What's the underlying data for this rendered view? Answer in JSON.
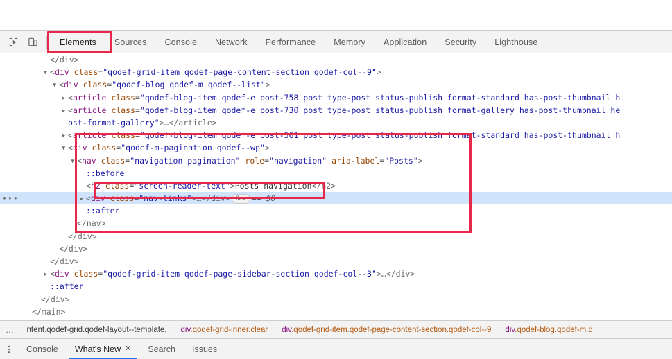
{
  "devtools": {
    "toolbar": {
      "icons": [
        {
          "name": "inspect-element-icon",
          "glyph": "inspect"
        },
        {
          "name": "device-toolbar-icon",
          "glyph": "device"
        }
      ],
      "tabs": [
        {
          "label": "Elements",
          "selected": true
        },
        {
          "label": "Sources",
          "selected": false
        },
        {
          "label": "Console",
          "selected": false
        },
        {
          "label": "Network",
          "selected": false
        },
        {
          "label": "Performance",
          "selected": false
        },
        {
          "label": "Memory",
          "selected": false
        },
        {
          "label": "Application",
          "selected": false
        },
        {
          "label": "Security",
          "selected": false
        },
        {
          "label": "Lighthouse",
          "selected": false
        }
      ]
    },
    "annotations": {
      "color": "#e8284a",
      "items": [
        {
          "name": "elements-tab-highlight"
        },
        {
          "name": "pagination-block-highlight"
        },
        {
          "name": "nav-links-line-highlight"
        }
      ]
    },
    "dom_tree": {
      "gutter_more_marker": "•••",
      "lines": [
        {
          "indent": 3,
          "triangle": "none",
          "clipped_top": true,
          "segments": [
            {
              "t": "punct",
              "v": "</div>"
            }
          ]
        },
        {
          "indent": 3,
          "triangle": "open",
          "segments": [
            {
              "t": "punct",
              "v": "<"
            },
            {
              "t": "tag",
              "v": "div"
            },
            {
              "t": "punct",
              "v": " "
            },
            {
              "t": "attr",
              "v": "class"
            },
            {
              "t": "punct",
              "v": "="
            },
            {
              "t": "val",
              "v": "\"qodef-grid-item qodef-page-content-section qodef-col--9\""
            },
            {
              "t": "punct",
              "v": ">"
            }
          ]
        },
        {
          "indent": 4,
          "triangle": "open",
          "segments": [
            {
              "t": "punct",
              "v": "<"
            },
            {
              "t": "tag",
              "v": "div"
            },
            {
              "t": "punct",
              "v": " "
            },
            {
              "t": "attr",
              "v": "class"
            },
            {
              "t": "punct",
              "v": "="
            },
            {
              "t": "val",
              "v": "\"qodef-blog qodef-m qodef--list\""
            },
            {
              "t": "punct",
              "v": ">"
            }
          ]
        },
        {
          "indent": 5,
          "triangle": "closed",
          "segments": [
            {
              "t": "punct",
              "v": "<"
            },
            {
              "t": "tag",
              "v": "article"
            },
            {
              "t": "punct",
              "v": " "
            },
            {
              "t": "attr",
              "v": "class"
            },
            {
              "t": "punct",
              "v": "="
            },
            {
              "t": "val",
              "v": "\"qodef-blog-item qodef-e post-758 post type-post status-publish format-standard has-post-thumbnail h"
            }
          ]
        },
        {
          "indent": 5,
          "triangle": "closed",
          "segments": [
            {
              "t": "punct",
              "v": "<"
            },
            {
              "t": "tag",
              "v": "article"
            },
            {
              "t": "punct",
              "v": " "
            },
            {
              "t": "attr",
              "v": "class"
            },
            {
              "t": "punct",
              "v": "="
            },
            {
              "t": "val",
              "v": "\"qodef-blog-item qodef-e post-730 post type-post status-publish format-gallery has-post-thumbnail he"
            }
          ]
        },
        {
          "indent": 5,
          "triangle": "none",
          "segments": [
            {
              "t": "val",
              "v": "ost-format-gallery\""
            },
            {
              "t": "punct",
              "v": ">"
            },
            {
              "t": "ellip",
              "v": "…"
            },
            {
              "t": "punct",
              "v": "</article>"
            }
          ]
        },
        {
          "indent": 5,
          "triangle": "closed",
          "segments": [
            {
              "t": "punct",
              "v": "<"
            },
            {
              "t": "tag",
              "v": "article"
            },
            {
              "t": "punct",
              "v": " "
            },
            {
              "t": "attr",
              "v": "class"
            },
            {
              "t": "punct",
              "v": "="
            },
            {
              "t": "val",
              "v": "\"qodef-blog-item qodef-e post-561 post type-post status-publish format-standard has-post-thumbnail h"
            }
          ]
        },
        {
          "indent": 5,
          "triangle": "open",
          "segments": [
            {
              "t": "punct",
              "v": "<"
            },
            {
              "t": "tag",
              "v": "div"
            },
            {
              "t": "punct",
              "v": " "
            },
            {
              "t": "attr",
              "v": "class"
            },
            {
              "t": "punct",
              "v": "="
            },
            {
              "t": "val",
              "v": "\"qodef-m-pagination qodef--wp\""
            },
            {
              "t": "punct",
              "v": ">"
            }
          ]
        },
        {
          "indent": 6,
          "triangle": "open",
          "segments": [
            {
              "t": "punct",
              "v": "<"
            },
            {
              "t": "tag",
              "v": "nav"
            },
            {
              "t": "punct",
              "v": " "
            },
            {
              "t": "attr",
              "v": "class"
            },
            {
              "t": "punct",
              "v": "="
            },
            {
              "t": "val",
              "v": "\"navigation pagination\""
            },
            {
              "t": "punct",
              "v": " "
            },
            {
              "t": "attr",
              "v": "role"
            },
            {
              "t": "punct",
              "v": "="
            },
            {
              "t": "val",
              "v": "\"navigation\""
            },
            {
              "t": "punct",
              "v": " "
            },
            {
              "t": "attr",
              "v": "aria-label"
            },
            {
              "t": "punct",
              "v": "="
            },
            {
              "t": "val",
              "v": "\"Posts\""
            },
            {
              "t": "punct",
              "v": ">"
            }
          ]
        },
        {
          "indent": 7,
          "triangle": "none",
          "segments": [
            {
              "t": "pseudo",
              "v": "::before"
            }
          ]
        },
        {
          "indent": 7,
          "triangle": "none",
          "segments": [
            {
              "t": "punct",
              "v": "<"
            },
            {
              "t": "tag",
              "v": "h2"
            },
            {
              "t": "punct",
              "v": " "
            },
            {
              "t": "attr",
              "v": "class"
            },
            {
              "t": "punct",
              "v": "="
            },
            {
              "t": "val",
              "v": "\"screen-reader-text\""
            },
            {
              "t": "punct",
              "v": ">"
            },
            {
              "t": "txt",
              "v": "Posts navigation"
            },
            {
              "t": "punct",
              "v": "</h2>"
            }
          ]
        },
        {
          "indent": 7,
          "triangle": "closed",
          "selected": true,
          "gutter_more": true,
          "segments": [
            {
              "t": "punct",
              "v": "<"
            },
            {
              "t": "tag",
              "v": "div"
            },
            {
              "t": "punct",
              "v": " "
            },
            {
              "t": "attr",
              "v": "class"
            },
            {
              "t": "punct",
              "v": "="
            },
            {
              "t": "val",
              "v": "\"nav-links\""
            },
            {
              "t": "punct",
              "v": ">"
            },
            {
              "t": "ellip",
              "v": "…"
            },
            {
              "t": "punct",
              "v": "</div>"
            },
            {
              "t": "badge",
              "v": "flex"
            },
            {
              "t": "dollar",
              "v": "== $0"
            }
          ]
        },
        {
          "indent": 7,
          "triangle": "none",
          "segments": [
            {
              "t": "pseudo",
              "v": "::after"
            }
          ]
        },
        {
          "indent": 6,
          "triangle": "none",
          "segments": [
            {
              "t": "punct",
              "v": "</nav>"
            }
          ]
        },
        {
          "indent": 5,
          "triangle": "none",
          "segments": [
            {
              "t": "punct",
              "v": "</div>"
            }
          ]
        },
        {
          "indent": 4,
          "triangle": "none",
          "segments": [
            {
              "t": "punct",
              "v": "</div>"
            }
          ]
        },
        {
          "indent": 3,
          "triangle": "none",
          "segments": [
            {
              "t": "punct",
              "v": "</div>"
            }
          ]
        },
        {
          "indent": 3,
          "triangle": "closed",
          "segments": [
            {
              "t": "punct",
              "v": "<"
            },
            {
              "t": "tag",
              "v": "div"
            },
            {
              "t": "punct",
              "v": " "
            },
            {
              "t": "attr",
              "v": "class"
            },
            {
              "t": "punct",
              "v": "="
            },
            {
              "t": "val",
              "v": "\"qodef-grid-item qodef-page-sidebar-section qodef-col--3\""
            },
            {
              "t": "punct",
              "v": ">"
            },
            {
              "t": "ellip",
              "v": "…"
            },
            {
              "t": "punct",
              "v": "</div>"
            }
          ]
        },
        {
          "indent": 3,
          "triangle": "none",
          "segments": [
            {
              "t": "pseudo",
              "v": "::after"
            }
          ]
        },
        {
          "indent": 2,
          "triangle": "none",
          "segments": [
            {
              "t": "punct",
              "v": "</div>"
            }
          ]
        },
        {
          "indent": 1,
          "triangle": "none",
          "segments": [
            {
              "t": "punct",
              "v": "</main>"
            }
          ]
        },
        {
          "indent": 0,
          "triangle": "none",
          "segments": [
            {
              "t": "punct",
              "v": "</div>"
            }
          ]
        }
      ]
    },
    "breadcrumbs": {
      "more": "…",
      "items": [
        {
          "tag": "ntent",
          "classes": ".qodef-grid.qodef-layout--template.",
          "selected": true
        },
        {
          "tag": "div",
          "classes": ".qodef-grid-inner.clear",
          "selected": false
        },
        {
          "tag": "div",
          "classes": ".qodef-grid-item.qodef-page-content-section.qodef-col--9",
          "selected": false
        },
        {
          "tag": "div",
          "classes": ".qodef-blog.qodef-m.q",
          "selected": false
        }
      ]
    },
    "drawer": {
      "menu_icon": "more-vertical-icon",
      "tabs": [
        {
          "label": "Console",
          "selected": false,
          "closable": false
        },
        {
          "label": "What's New",
          "selected": true,
          "closable": true
        },
        {
          "label": "Search",
          "selected": false,
          "closable": false
        },
        {
          "label": "Issues",
          "selected": false,
          "closable": false
        }
      ],
      "close_glyph": "✕"
    }
  }
}
